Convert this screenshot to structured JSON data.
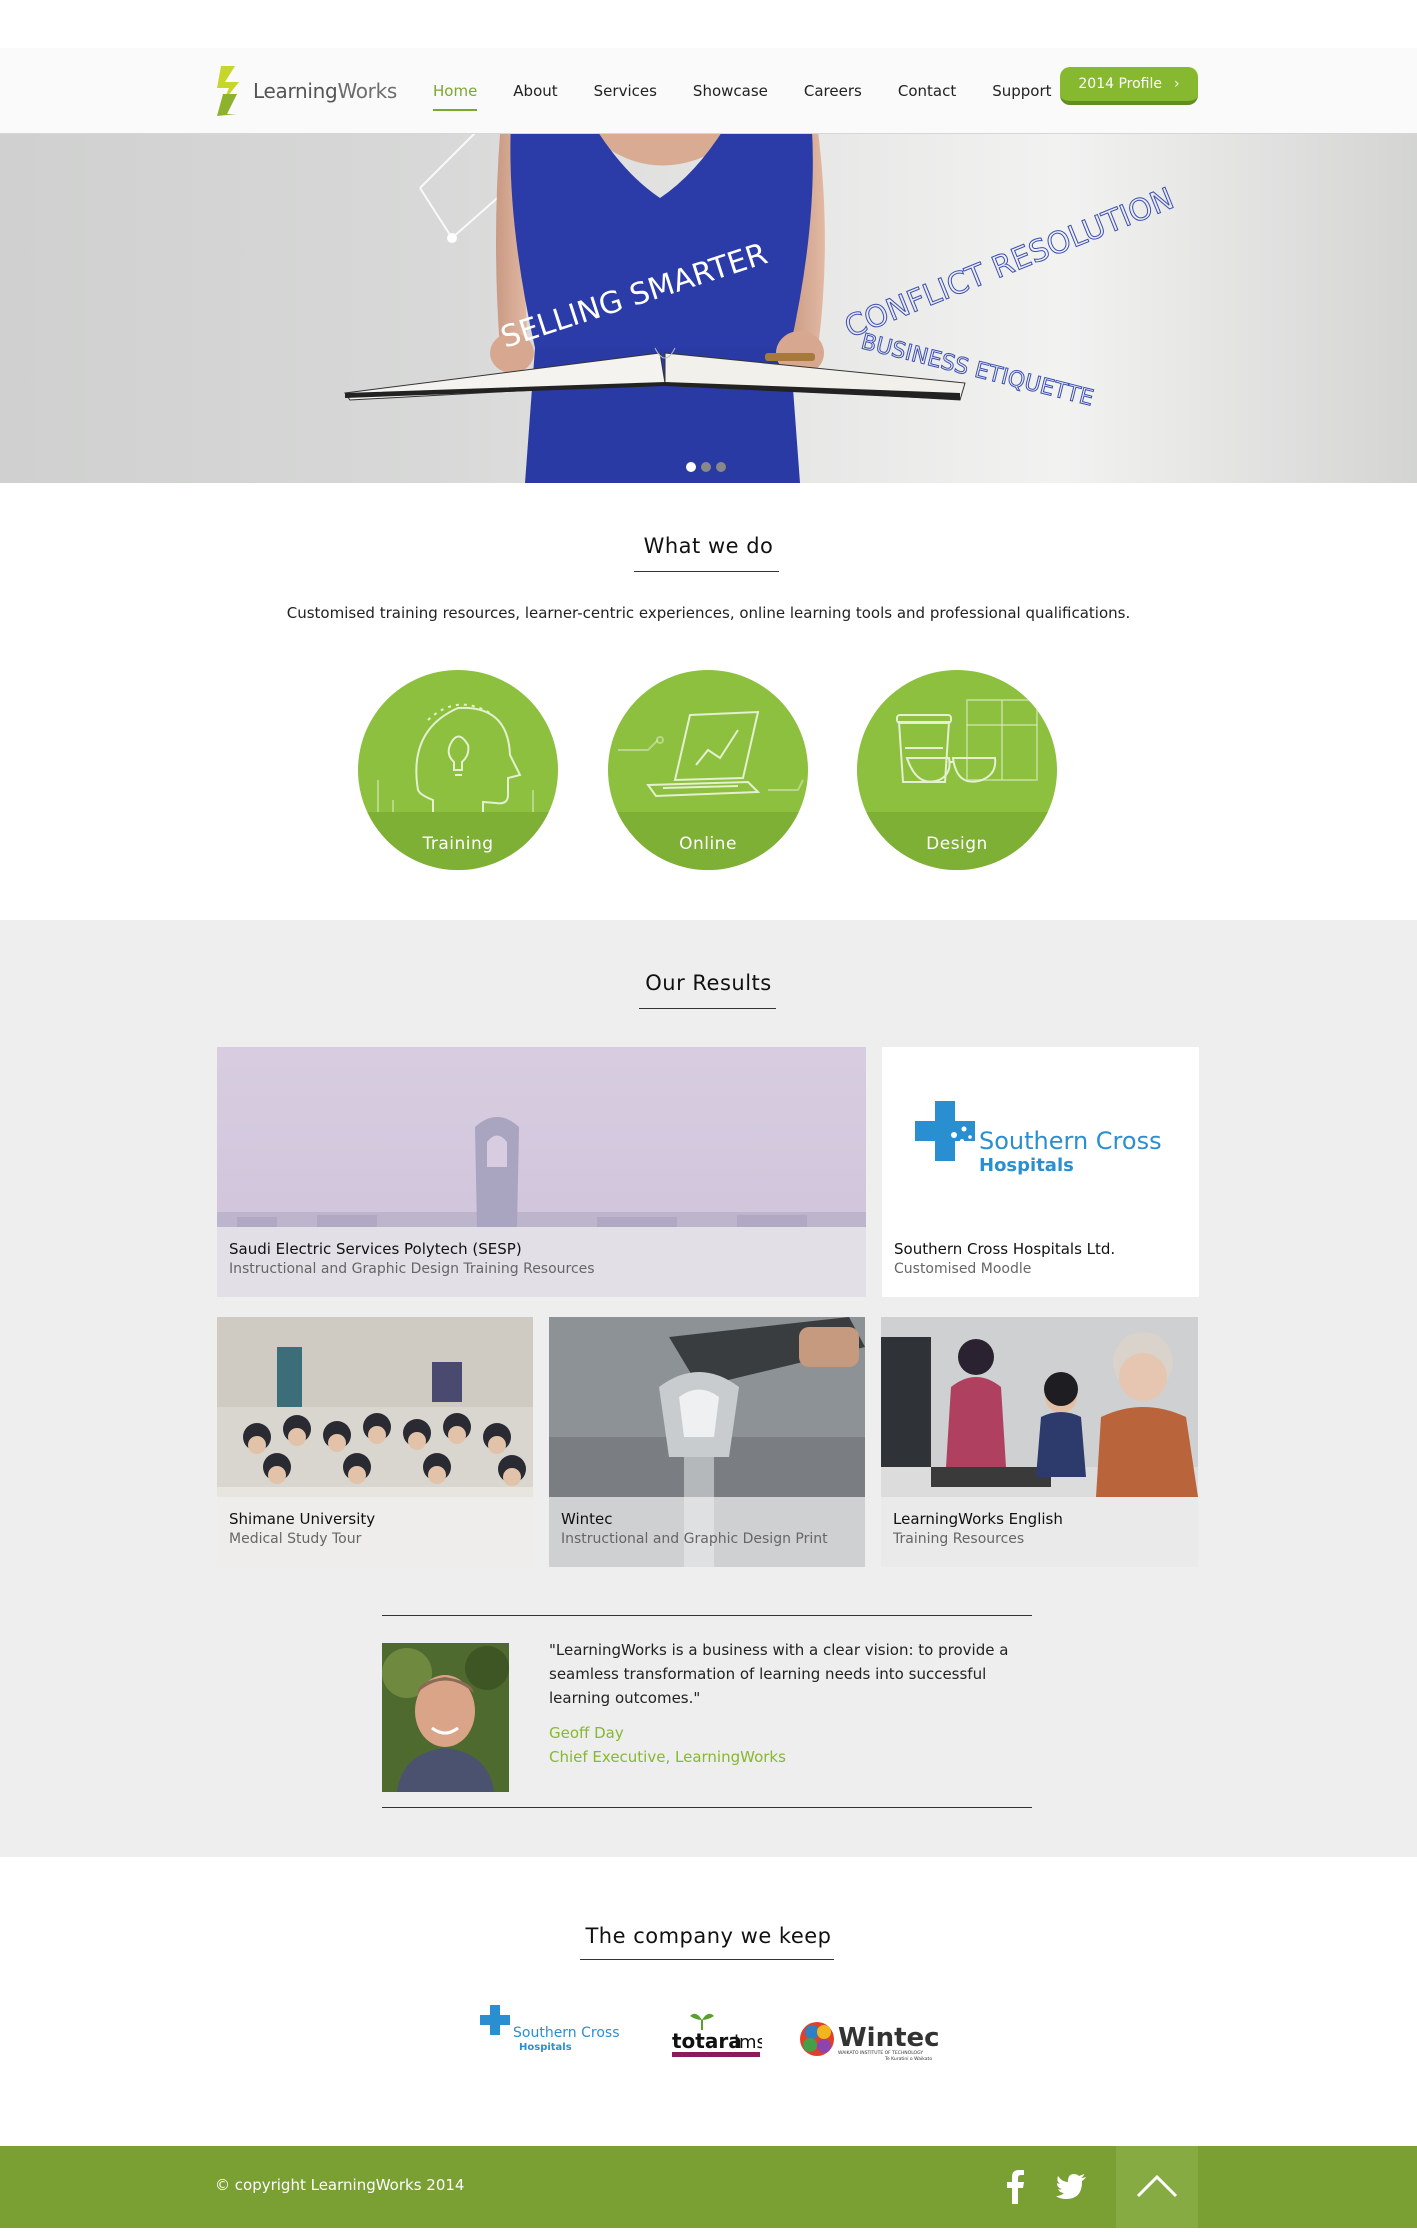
{
  "header": {
    "logo": {
      "text_a": "Learning",
      "text_b": "Works"
    },
    "nav": [
      "Home",
      "About",
      "Services",
      "Showcase",
      "Careers",
      "Contact",
      "Support"
    ],
    "active_nav": "Home",
    "profile_button": "2014 Profile"
  },
  "hero": {
    "words_left": "SELLING SMARTER",
    "words_right_1": "CONFLICT RESOLUTION",
    "words_right_2": "BUSINESS ETIQUETTE",
    "slides": 3,
    "active_slide": 1
  },
  "what_we_do": {
    "title": "What we do",
    "description": "Customised training resources, learner-centric experiences, online learning tools and professional qualifications.",
    "items": [
      {
        "label": "Training",
        "icon": "head-lightbulb-icon"
      },
      {
        "label": "Online",
        "icon": "laptop-icon"
      },
      {
        "label": "Design",
        "icon": "cup-glasses-icon"
      }
    ]
  },
  "results": {
    "title": "Our Results",
    "cards": [
      {
        "title": "Saudi Electric Services Polytech (SESP)",
        "subtitle": "Instructional and Graphic Design Training Resources"
      },
      {
        "title": "Southern Cross Hospitals Ltd.",
        "subtitle": "Customised Moodle",
        "logo_a": "Southern Cross",
        "logo_b": "Hospitals"
      },
      {
        "title": "Shimane University",
        "subtitle": "Medical Study Tour"
      },
      {
        "title": "Wintec",
        "subtitle": "Instructional and Graphic Design Print"
      },
      {
        "title": "LearningWorks English",
        "subtitle": "Training Resources"
      }
    ]
  },
  "testimonial": {
    "quote": "\"LearningWorks is a business with a clear vision: to provide a seamless transformation of learning needs into successful learning outcomes.\"",
    "name": "Geoff Day",
    "role": "Chief Executive, LearningWorks"
  },
  "partners": {
    "title": "The company we keep",
    "logos": [
      {
        "name": "southern-cross-logo",
        "text_a": "Southern Cross",
        "text_b": "Hospitals"
      },
      {
        "name": "totara-logo",
        "text_a": "totara",
        "text_b": "lms",
        "text_c": "solutions partner"
      },
      {
        "name": "wintec-logo",
        "text_a": "Wintec",
        "text_b": "WAIKATO INSTITUTE OF TECHNOLOGY",
        "text_c": "Te Kuratini o Waikato"
      }
    ]
  },
  "footer": {
    "copyright": "© copyright LearningWorks 2014",
    "social": [
      "facebook-icon",
      "twitter-icon"
    ],
    "back_to_top": "arrow-up-icon"
  },
  "colors": {
    "brand_green": "#86b830",
    "footer_green": "#7a9f33",
    "hero_dress": "#2a3aa6",
    "southern_cross_blue": "#2a8fd0"
  }
}
